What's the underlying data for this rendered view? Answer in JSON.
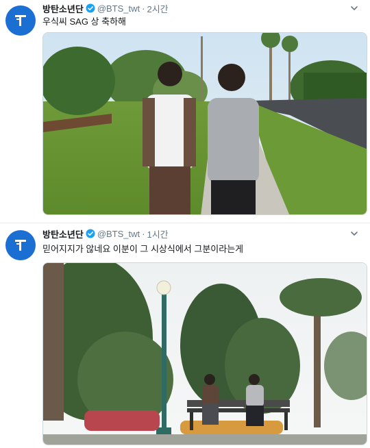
{
  "tweets": [
    {
      "author_name": "방탄소년단",
      "handle": "@BTS_twt",
      "separator": "·",
      "time": "2시간",
      "text": "우식씨 SAG 상 축하해",
      "media_icon": "photo",
      "avatar_icon": "bts-logo-icon"
    },
    {
      "author_name": "방탄소년단",
      "handle": "@BTS_twt",
      "separator": "·",
      "time": "1시간",
      "text": "믿어지지가 않네요 이분이 그 시상식에서 그분이라는게",
      "media_icon": "photo",
      "avatar_icon": "bts-logo-icon"
    }
  ],
  "colors": {
    "avatar_bg": "#1b6fd3",
    "verified": "#1da1f2",
    "secondary_text": "#657786",
    "primary_text": "#14171a"
  }
}
